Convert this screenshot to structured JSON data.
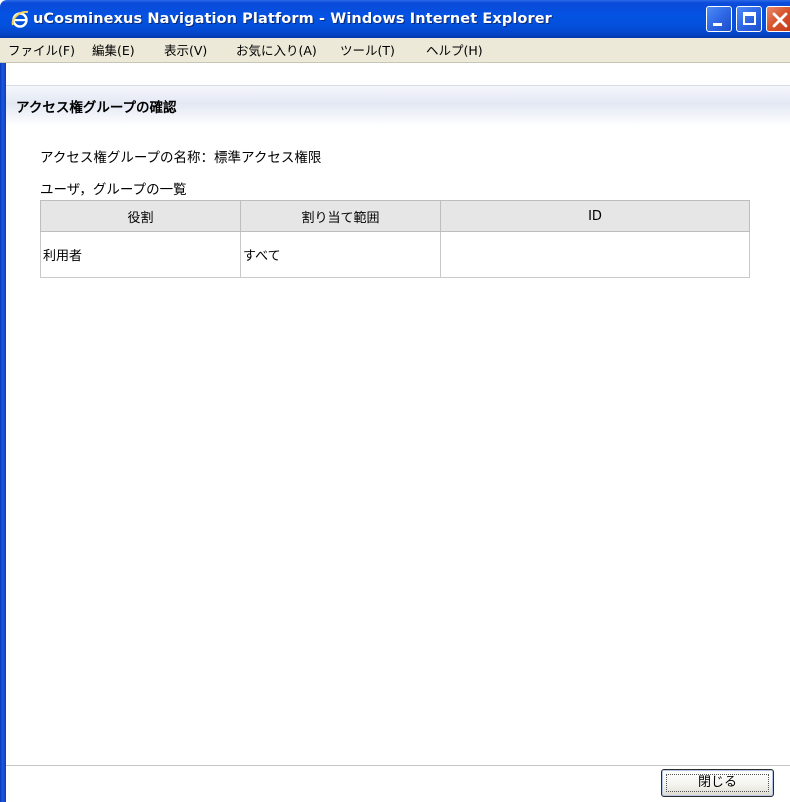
{
  "window": {
    "title": "uCosminexus Navigation Platform - Windows Internet Explorer",
    "icon": "ie-logo-icon"
  },
  "menubar": {
    "items": [
      {
        "label": "ファイル(F)"
      },
      {
        "label": "編集(E)"
      },
      {
        "label": "表示(V)"
      },
      {
        "label": "お気に入り(A)"
      },
      {
        "label": "ツール(T)"
      },
      {
        "label": "ヘルプ(H)"
      }
    ]
  },
  "page": {
    "title": "アクセス権グループの確認",
    "group_name_label": "アクセス権グループの名称：標準アクセス権限",
    "list_label": "ユーザ，グループの一覧"
  },
  "table": {
    "columns": [
      "役割",
      "割り当て範囲",
      "ID"
    ],
    "rows": [
      [
        "利用者",
        "すべて",
        ""
      ]
    ]
  },
  "footer": {
    "close_label": "閉じる"
  },
  "colors": {
    "titlebar": "#0452e2",
    "menubar": "#ece9d8",
    "table_header": "#e6e6e6"
  }
}
